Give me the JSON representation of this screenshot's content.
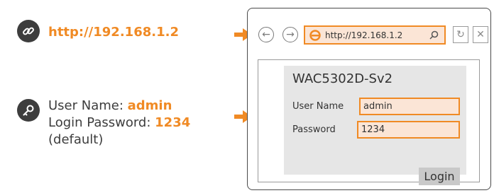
{
  "info": {
    "url": "http://192.168.1.2",
    "user_name_label": "User Name: ",
    "user_name_value": "admin",
    "password_label": "Login Password: ",
    "password_value": "1234",
    "password_note": "(default)"
  },
  "browser": {
    "address": "http://192.168.1.2",
    "back_icon": "←",
    "forward_icon": "→",
    "refresh_icon": "↻",
    "close_icon": "✕"
  },
  "login": {
    "device_name": "WAC5302D-Sv2",
    "user_name_label": "User Name",
    "user_name_value": "admin",
    "password_label": "Password",
    "password_value": "1234",
    "login_button": "Login"
  },
  "colors": {
    "accent": "#f08a24",
    "field_bg": "#fbe5d6",
    "icon_bg": "#3d3d3d"
  }
}
